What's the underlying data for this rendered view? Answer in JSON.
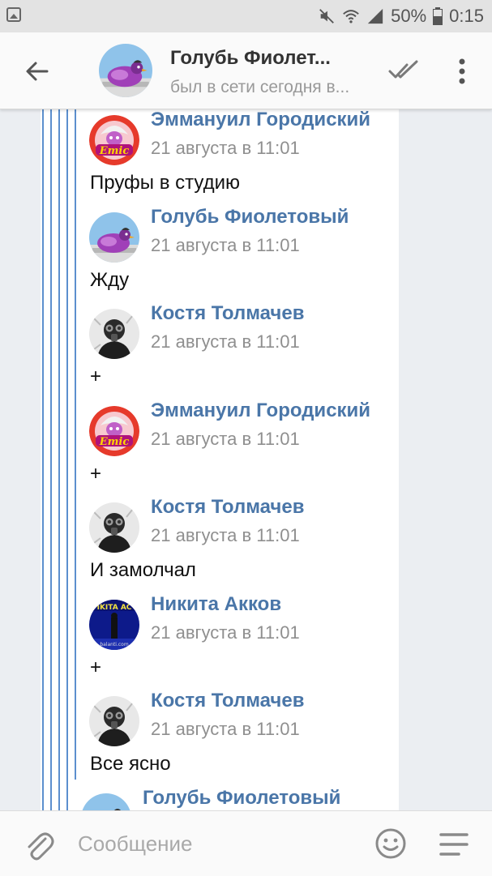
{
  "status_bar": {
    "battery": "50%",
    "time": "0:15"
  },
  "header": {
    "title": "Голубь Фиолет...",
    "subtitle": "был в сети сегодня в...",
    "back_icon": "arrow-left-icon",
    "read_icon": "double-check-icon",
    "menu_icon": "more-vert-icon"
  },
  "colors": {
    "accent": "#4a76a8",
    "thread_line": "#5c8fce",
    "background": "#ebeef2"
  },
  "messages": [
    {
      "name": "Эммануил Городиский",
      "time": "21 августа в 11:01",
      "text": "Пруфы в студию",
      "avatar": "emic-avatar"
    },
    {
      "name": "Голубь Фиолетовый",
      "time": "21 августа в 11:01",
      "text": "Жду",
      "avatar": "pigeon-avatar"
    },
    {
      "name": "Костя Толмачев",
      "time": "21 августа в 11:01",
      "text": "+",
      "avatar": "gasmask-avatar"
    },
    {
      "name": "Эммануил Городиский",
      "time": "21 августа в 11:01",
      "text": "+",
      "avatar": "emic-avatar"
    },
    {
      "name": "Костя Толмачев",
      "time": "21 августа в 11:01",
      "text": "И замолчал",
      "avatar": "gasmask-avatar"
    },
    {
      "name": "Никита Акков",
      "time": "21 августа в 11:01",
      "text": "+",
      "avatar": "stage-avatar"
    },
    {
      "name": "Костя Толмачев",
      "time": "21 августа в 11:01",
      "text": "Все ясно",
      "avatar": "gasmask-avatar"
    }
  ],
  "partial_message": {
    "name": "Голубь Фиолетовый",
    "avatar": "pigeon-avatar"
  },
  "composer": {
    "placeholder": "Сообщение",
    "attach_icon": "paperclip-icon",
    "emoji_icon": "smiley-icon",
    "keyboard_icon": "menu-lines-icon"
  }
}
